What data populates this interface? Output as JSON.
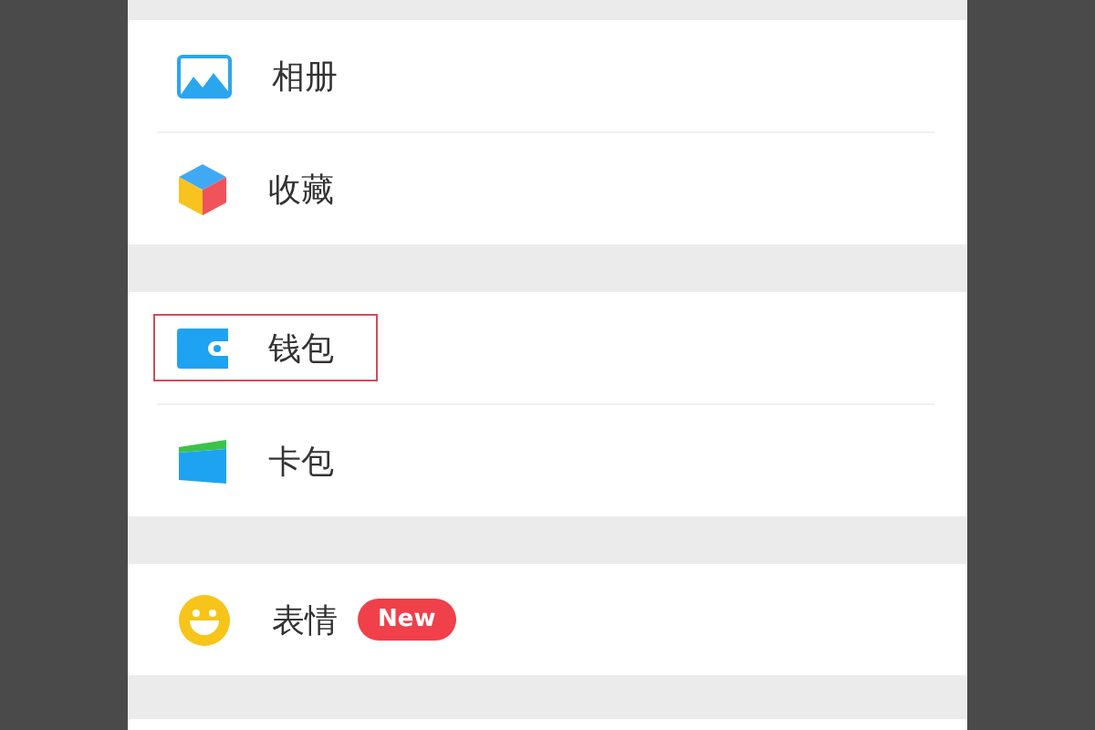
{
  "groups": [
    {
      "items": [
        {
          "kind": "photo",
          "label": "相册",
          "highlighted": false
        },
        {
          "kind": "cube",
          "label": "收藏",
          "highlighted": false
        }
      ]
    },
    {
      "items": [
        {
          "kind": "wallet",
          "label": "钱包",
          "highlighted": true
        },
        {
          "kind": "card",
          "label": "卡包",
          "highlighted": false
        }
      ]
    },
    {
      "items": [
        {
          "kind": "smile",
          "label": "表情",
          "badge": "New",
          "highlighted": false
        }
      ]
    }
  ]
}
